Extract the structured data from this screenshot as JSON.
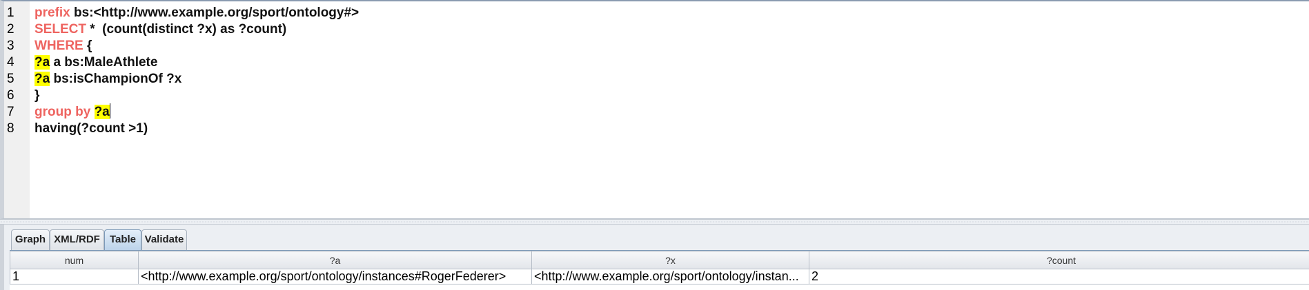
{
  "editor": {
    "line_numbers": [
      "1",
      "2",
      "3",
      "4",
      "5",
      "6",
      "7",
      "8"
    ],
    "lines": [
      {
        "keyword": "prefix",
        "rest": " bs:<http://www.example.org/sport/ontology#>"
      },
      {
        "keyword": "SELECT",
        "rest": " *  (count(distinct ?x) as ?count)"
      },
      {
        "keyword": "WHERE",
        "rest": " {"
      },
      {
        "var": "?a",
        "rest": " a bs:MaleAthlete"
      },
      {
        "var": "?a",
        "rest": " bs:isChampionOf ?x"
      },
      {
        "rest": "}"
      },
      {
        "keyword": "group by",
        "var": "?a"
      },
      {
        "rest": "having(?count >1)"
      }
    ]
  },
  "tabs": [
    "Graph",
    "XML/RDF",
    "Table",
    "Validate"
  ],
  "active_tab": "Table",
  "results": {
    "columns": [
      "num",
      "?a",
      "?x",
      "?count"
    ],
    "rows": [
      [
        "1",
        "<http://www.example.org/sport/ontology/instances#RogerFederer>",
        "<http://www.example.org/sport/ontology/instan...",
        "2"
      ]
    ]
  },
  "colors": {
    "keyword": "#ee6460",
    "highlight": "#ffff00",
    "active_tab": "#bcd3ea"
  }
}
